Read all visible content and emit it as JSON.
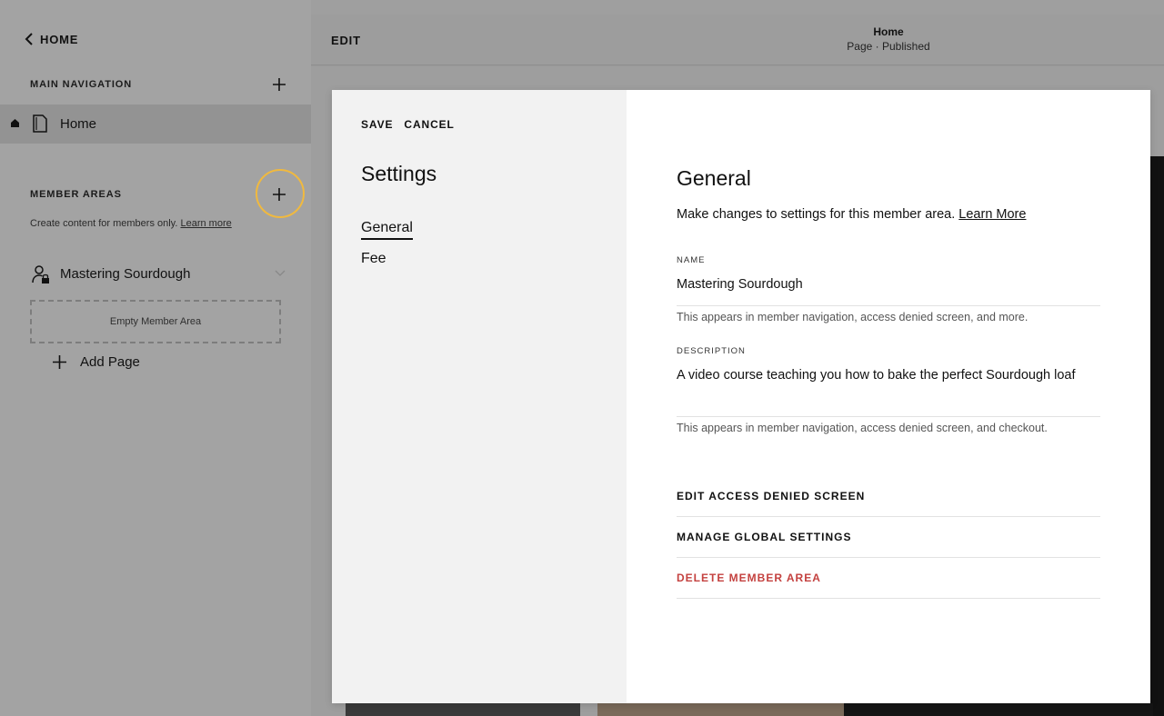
{
  "sidebar": {
    "back_label": "HOME",
    "main_navigation_label": "MAIN NAVIGATION",
    "nav_items": [
      {
        "label": "Home"
      }
    ],
    "member_areas_label": "MEMBER AREAS",
    "member_areas_help": "Create content for members only.",
    "member_areas_help_link": "Learn more",
    "member_area": {
      "label": "Mastering Sourdough"
    },
    "empty_area_label": "Empty Member Area",
    "add_page_label": "Add Page"
  },
  "topbar": {
    "edit_label": "EDIT",
    "page_title": "Home",
    "page_status": "Page · Published"
  },
  "modal": {
    "save_label": "SAVE",
    "cancel_label": "CANCEL",
    "title": "Settings",
    "menu": [
      {
        "label": "General"
      },
      {
        "label": "Fee"
      }
    ],
    "general": {
      "heading": "General",
      "description": "Make changes to settings for this member area.",
      "description_link": "Learn More",
      "name_label": "NAME",
      "name_value": "Mastering Sourdough",
      "name_hint": "This appears in member navigation, access denied screen, and more.",
      "description_label": "DESCRIPTION",
      "description_value": "A video course teaching you how to bake the perfect Sourdough loaf",
      "description_hint": "This appears in member navigation, access denied screen, and checkout.",
      "actions": [
        {
          "label": "EDIT ACCESS DENIED SCREEN"
        },
        {
          "label": "MANAGE GLOBAL SETTINGS"
        },
        {
          "label": "DELETE MEMBER AREA"
        }
      ]
    }
  },
  "colors": {
    "highlight_ring": "#f0b93f",
    "danger": "#c4413f",
    "sidebar_bg": "#a3a3a3"
  }
}
